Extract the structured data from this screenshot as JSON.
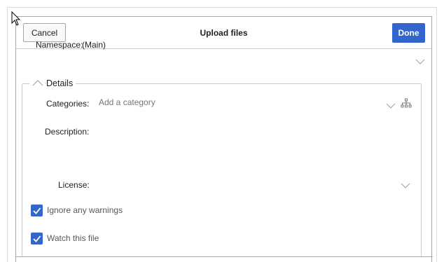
{
  "dialog": {
    "title": "Upload files",
    "cancel_label": "Cancel",
    "done_label": "Done"
  },
  "namespace": {
    "label": "Namespace:",
    "value": "(Main)"
  },
  "details": {
    "legend": "Details",
    "categories_label": "Categories:",
    "categories_placeholder": "Add a category",
    "description_label": "Description:",
    "license_label": "License:"
  },
  "options": {
    "ignore_warnings_label": "Ignore any warnings",
    "ignore_warnings_checked": true,
    "watch_file_label": "Watch this file",
    "watch_file_checked": true
  },
  "colors": {
    "accent": "#3366cc",
    "border": "#c8ccd1",
    "muted_text": "#72777d"
  }
}
